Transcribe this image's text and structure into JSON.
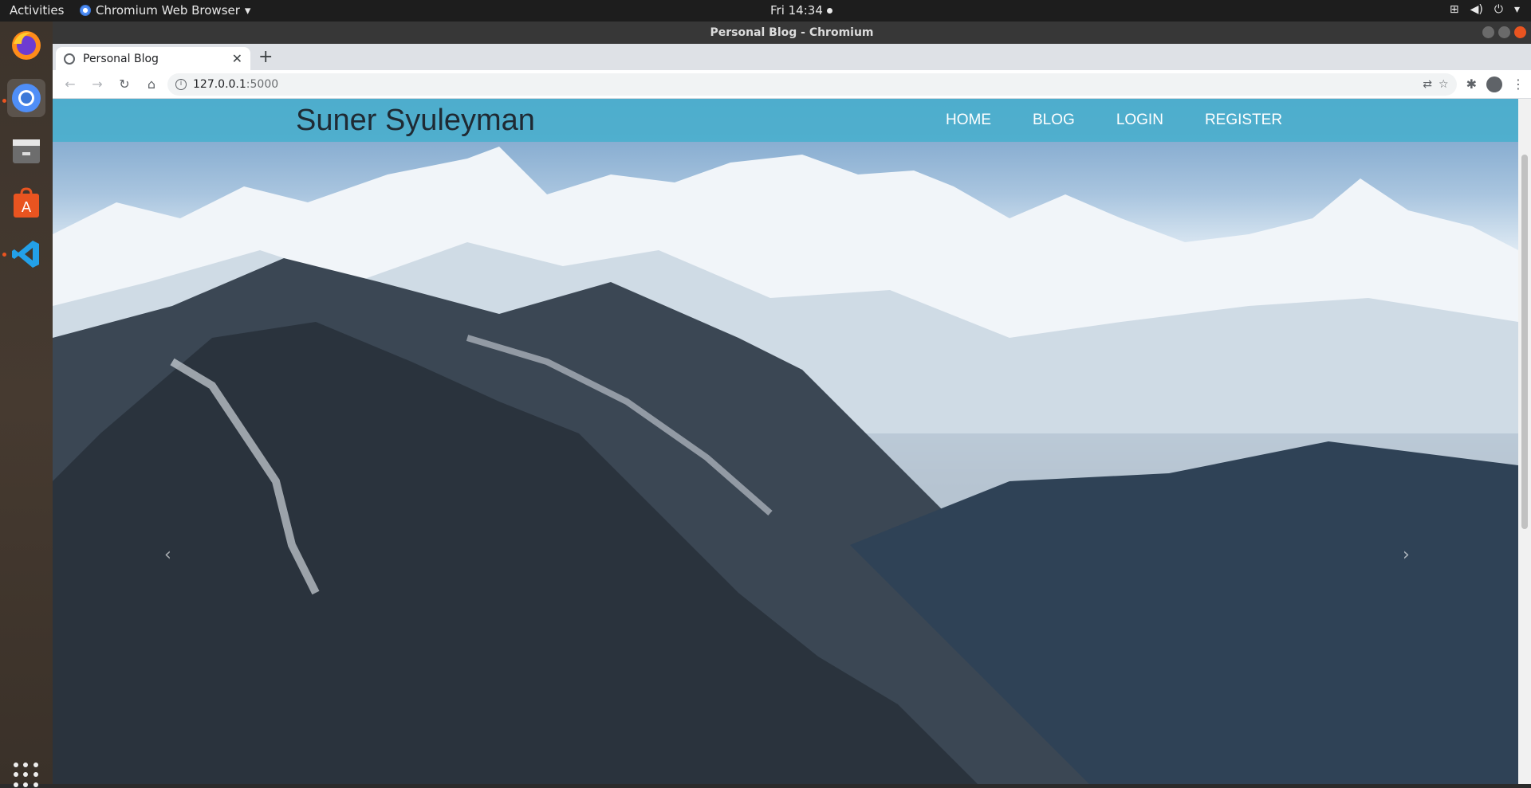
{
  "topbar": {
    "activities": "Activities",
    "app_name": "Chromium Web Browser",
    "clock": "Fri 14:34"
  },
  "window": {
    "title": "Personal Blog - Chromium"
  },
  "tab": {
    "title": "Personal Blog"
  },
  "omnibox": {
    "host": "127.0.0.1",
    "port": ":5000"
  },
  "site": {
    "brand": "Suner Syuleyman",
    "nav": [
      "HOME",
      "BLOG",
      "LOGIN",
      "REGISTER"
    ]
  },
  "icons": {
    "dock": [
      "firefox-icon",
      "chromium-icon",
      "files-icon",
      "software-center-icon",
      "vscode-icon",
      "show-apps-icon"
    ]
  },
  "colors": {
    "navbar": "#4bafcd",
    "brand_text": "#1f2a33",
    "ubuntu_orange": "#e95420"
  }
}
